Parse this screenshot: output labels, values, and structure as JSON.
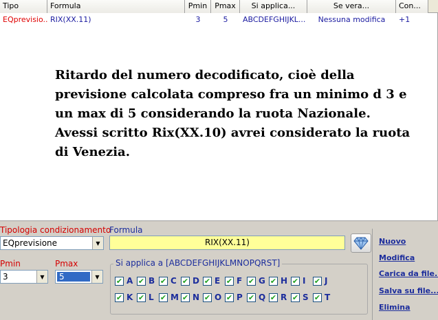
{
  "grid": {
    "columns": [
      "Tipo",
      "Formula",
      "Pmin",
      "Pmax",
      "Si applica...",
      "Se vera...",
      "Con..."
    ],
    "row": {
      "tipo": "EQprevisio...",
      "formula": "RIX(XX.11)",
      "pmin": "3",
      "pmax": "5",
      "si_applica": "ABCDEFGHIJKL...",
      "se_vera": "Nessuna modifica",
      "con": "+1"
    }
  },
  "annotation": "Ritardo del numero decodificato, cioè della previsione calcolata compreso fra un minimo d 3 e un max di 5 considerando la ruota Nazionale. Avessi scritto Rix(XX.10) avrei considerato la ruota di Venezia.",
  "form": {
    "tipologia_label": "Tipologia condizionamento",
    "tipologia_value": "EQprevisione",
    "formula_label": "Formula",
    "formula_value": "RIX(XX.11)",
    "pmin_label": "Pmin",
    "pmin_value": "3",
    "pmax_label": "Pmax",
    "pmax_value": "5",
    "si_applica_legend": "Si applica a [ABCDEFGHIJKLMNOPQRST]",
    "letters_row1": [
      "A",
      "B",
      "C",
      "D",
      "E",
      "F",
      "G",
      "H",
      "I",
      "J"
    ],
    "letters_row2": [
      "K",
      "L",
      "M",
      "N",
      "O",
      "P",
      "Q",
      "R",
      "S",
      "T"
    ],
    "checkmark": "✔",
    "dropdown_arrow": "▼"
  },
  "side": {
    "nuovo": "Nuovo",
    "modifica": "Modifica",
    "carica": "Carica da file...",
    "salva": "Salva su file...",
    "elimina": "Elimina"
  },
  "icons": {
    "diamond": "diamond-icon"
  },
  "colors": {
    "link": "#1c2d9c",
    "tipo_text": "#e00000",
    "formula_bg": "#ffff99",
    "selection": "#316ac5"
  }
}
